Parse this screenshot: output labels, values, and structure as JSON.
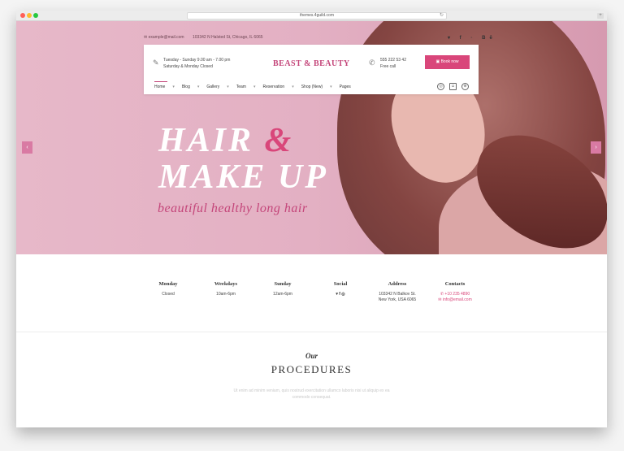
{
  "browser": {
    "url": "themes.4guild.com"
  },
  "topbar": {
    "email": "example@mail.com",
    "address": "103342 N Halsted St, Chicago, IL 6065",
    "social": "▾ f ◦ Bē"
  },
  "nav": {
    "hours_line1": "Tuesday - Sunday 9.00 am - 7.00 pm",
    "hours_line2": "Saturday & Monday Closed",
    "logo": "BEAST & BEAUTY",
    "phone": "555 222 53 42",
    "phone_sub": "Free call",
    "book_label": "Book now",
    "menu": [
      "Home",
      "Blog",
      "Gallery",
      "Team",
      "Reservation",
      "Shop (New)",
      "Pages"
    ]
  },
  "hero": {
    "line1": "HAIR",
    "amp": "&",
    "line2": "MAKE UP",
    "tagline": "beautiful healthy long hair",
    "prev": "‹",
    "next": "›"
  },
  "info": {
    "monday": {
      "title": "Monday",
      "value": "Closed"
    },
    "weekdays": {
      "title": "Weekdays",
      "value": "10am-6pm"
    },
    "sunday": {
      "title": "Sunday",
      "value": "12am-6pm"
    },
    "social": {
      "title": "Social",
      "icons": "▾  f  ◎"
    },
    "address": {
      "title": "Address",
      "line1": "103342 N Balkov St.",
      "line2": "New York, USA 6065"
    },
    "contacts": {
      "title": "Contacts",
      "phone": "+10 235 4890",
      "email": "info@email.com"
    }
  },
  "procedures": {
    "our": "Our",
    "title": "PROCEDURES",
    "desc": "Ut enim ad minim veniam, quis nostrud exercitation ullamco laboris nisi ut aliquip ex ea commodo consequat."
  },
  "colors": {
    "accent": "#d9467a",
    "hero_bg": "#e3b0c3"
  }
}
